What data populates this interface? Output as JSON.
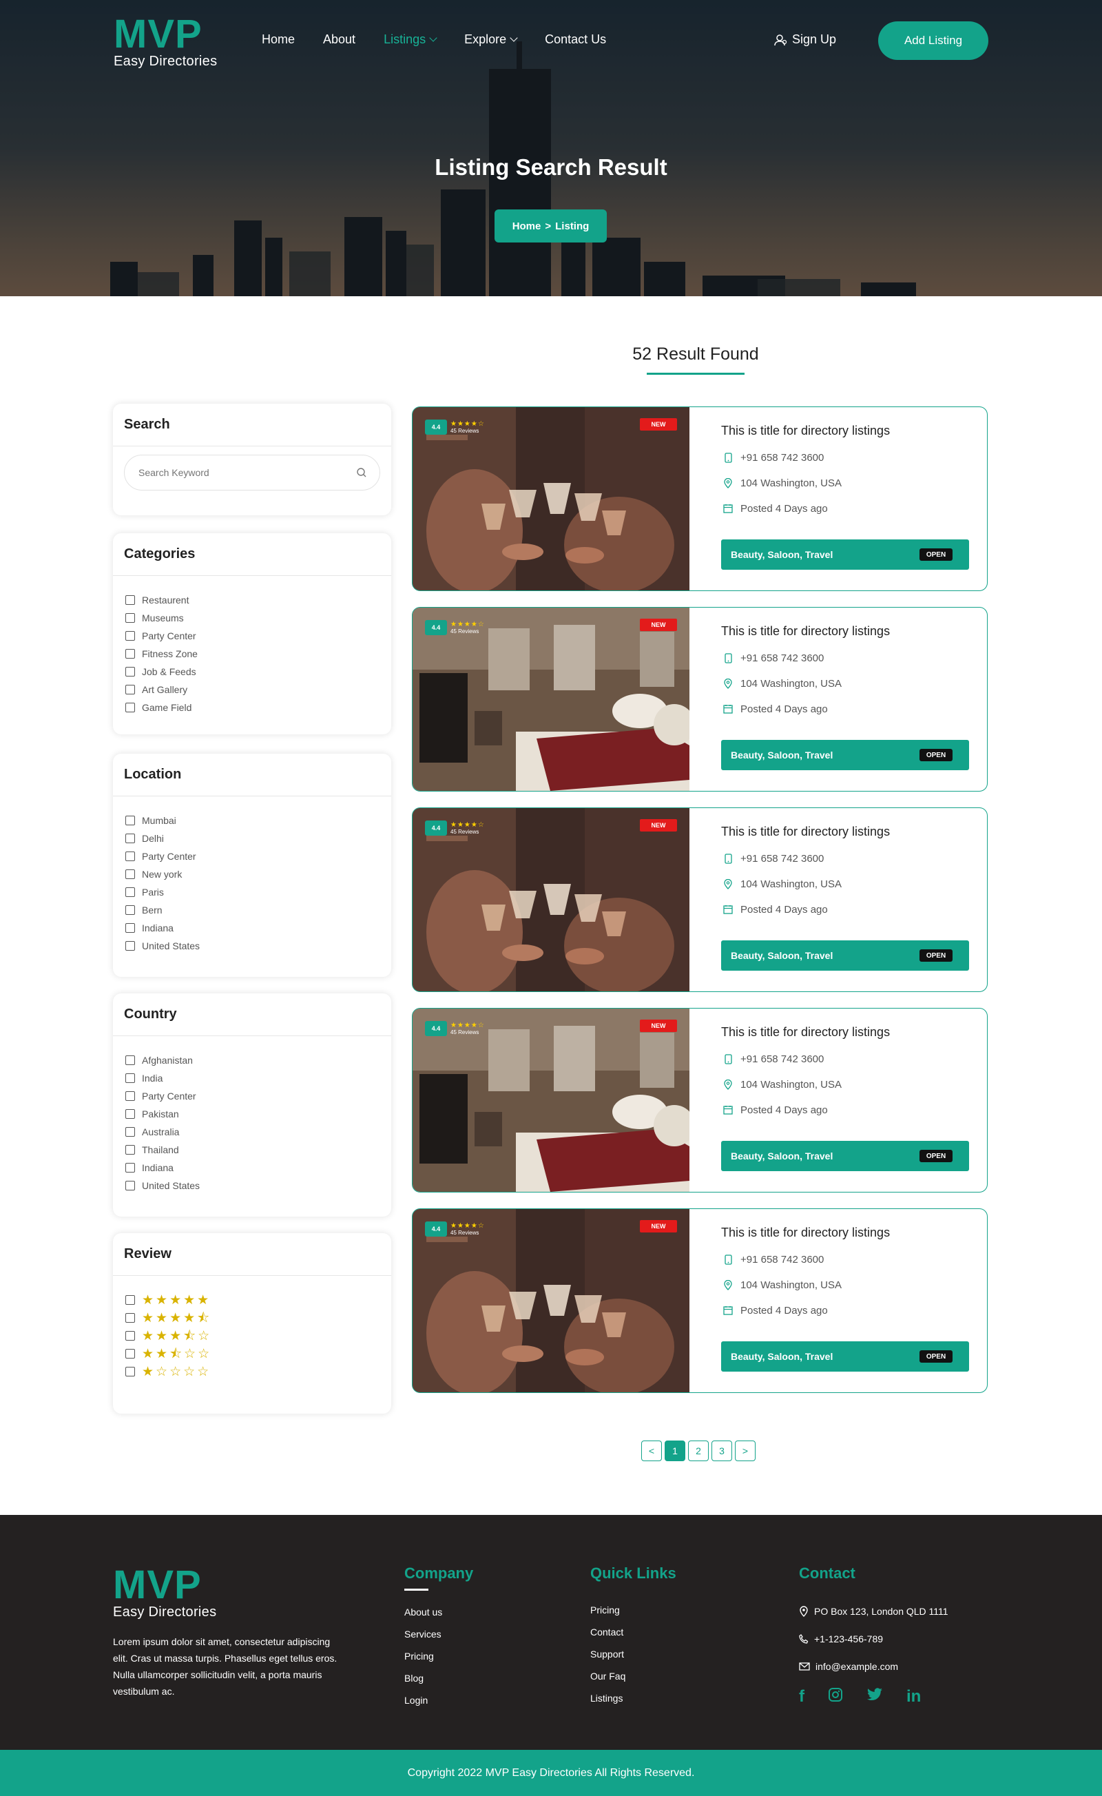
{
  "brand": {
    "name": "MVP",
    "tagline": "Easy Directories",
    "accent": "#13a38a"
  },
  "nav": {
    "links": [
      {
        "label": "Home",
        "active": false,
        "dropdown": false
      },
      {
        "label": "About",
        "active": false,
        "dropdown": false
      },
      {
        "label": "Listings",
        "active": true,
        "dropdown": true
      },
      {
        "label": "Explore",
        "active": false,
        "dropdown": true
      },
      {
        "label": "Contact Us",
        "active": false,
        "dropdown": false
      }
    ],
    "signup_label": "Sign Up",
    "add_listing_label": "Add Listing"
  },
  "hero": {
    "title": "Listing Search Result",
    "breadcrumb": {
      "home": "Home",
      "separator": ">",
      "current": "Listing"
    }
  },
  "results": {
    "heading": "52 Result Found"
  },
  "sidebar": {
    "search": {
      "title": "Search",
      "placeholder": "Search Keyword",
      "icon": "search-icon"
    },
    "categories": {
      "title": "Categories",
      "items": [
        "Restaurent",
        "Museums",
        "Party Center",
        "Fitness Zone",
        "Job & Feeds",
        "Art Gallery",
        "Game Field"
      ]
    },
    "location": {
      "title": "Location",
      "items": [
        "Mumbai",
        "Delhi",
        "Party Center",
        "New york",
        "Paris",
        "Bern",
        "Indiana",
        "United States"
      ]
    },
    "country": {
      "title": "Country",
      "items": [
        "Afghanistan",
        "India",
        "Party Center",
        "Pakistan",
        "Australia",
        "Thailand",
        "Indiana",
        "United States"
      ]
    },
    "review": {
      "title": "Review",
      "levels": [
        5,
        4.5,
        3.5,
        2.5,
        1
      ]
    }
  },
  "listings": [
    {
      "image": "party-toast",
      "rating": "4.4",
      "reviews": "45 Reviews",
      "badge": "NEW",
      "title": "This is title for directory listings",
      "phone": "+91 658 742 3600",
      "address": "104 Washington, USA",
      "posted": "Posted 4 Days ago",
      "tags": "Beauty, Saloon, Travel",
      "status": "OPEN"
    },
    {
      "image": "hotel-room",
      "rating": "4.4",
      "reviews": "45 Reviews",
      "badge": "NEW",
      "title": "This is title for directory listings",
      "phone": "+91 658 742 3600",
      "address": "104 Washington, USA",
      "posted": "Posted 4 Days ago",
      "tags": "Beauty, Saloon, Travel",
      "status": "OPEN"
    },
    {
      "image": "party-toast",
      "rating": "4.4",
      "reviews": "45 Reviews",
      "badge": "NEW",
      "title": "This is title for directory listings",
      "phone": "+91 658 742 3600",
      "address": "104 Washington, USA",
      "posted": "Posted 4 Days ago",
      "tags": "Beauty, Saloon, Travel",
      "status": "OPEN"
    },
    {
      "image": "hotel-room",
      "rating": "4.4",
      "reviews": "45 Reviews",
      "badge": "NEW",
      "title": "This is title for directory listings",
      "phone": "+91 658 742 3600",
      "address": "104 Washington, USA",
      "posted": "Posted 4 Days ago",
      "tags": "Beauty, Saloon, Travel",
      "status": "OPEN"
    },
    {
      "image": "party-toast",
      "rating": "4.4",
      "reviews": "45 Reviews",
      "badge": "NEW",
      "title": "This is title for directory listings",
      "phone": "+91 658 742 3600",
      "address": "104 Washington, USA",
      "posted": "Posted 4 Days ago",
      "tags": "Beauty, Saloon, Travel",
      "status": "OPEN"
    }
  ],
  "pagination": {
    "prev": "<",
    "pages": [
      "1",
      "2",
      "3"
    ],
    "current": "1",
    "next": ">"
  },
  "footer": {
    "about": "Lorem ipsum dolor sit amet, consectetur adipiscing elit. Cras ut massa turpis. Phasellus eget tellus eros. Nulla ullamcorper sollicitudin velit, a porta mauris vestibulum ac.",
    "company": {
      "title": "Company",
      "links": [
        "About us",
        "Services",
        "Pricing",
        "Blog",
        "Login"
      ]
    },
    "quick_links": {
      "title": "Quick Links",
      "links": [
        "Pricing",
        "Contact",
        "Support",
        "Our Faq",
        "Listings"
      ]
    },
    "contact": {
      "title": "Contact",
      "address": "PO Box 123, London QLD 1111",
      "phone": "+1-123-456-789",
      "email": "info@example.com",
      "social": [
        "facebook-icon",
        "instagram-icon",
        "twitter-icon",
        "linkedin-icon"
      ]
    },
    "copyright": "Copyright 2022 MVP Easy Directories All Rights Reserved."
  }
}
